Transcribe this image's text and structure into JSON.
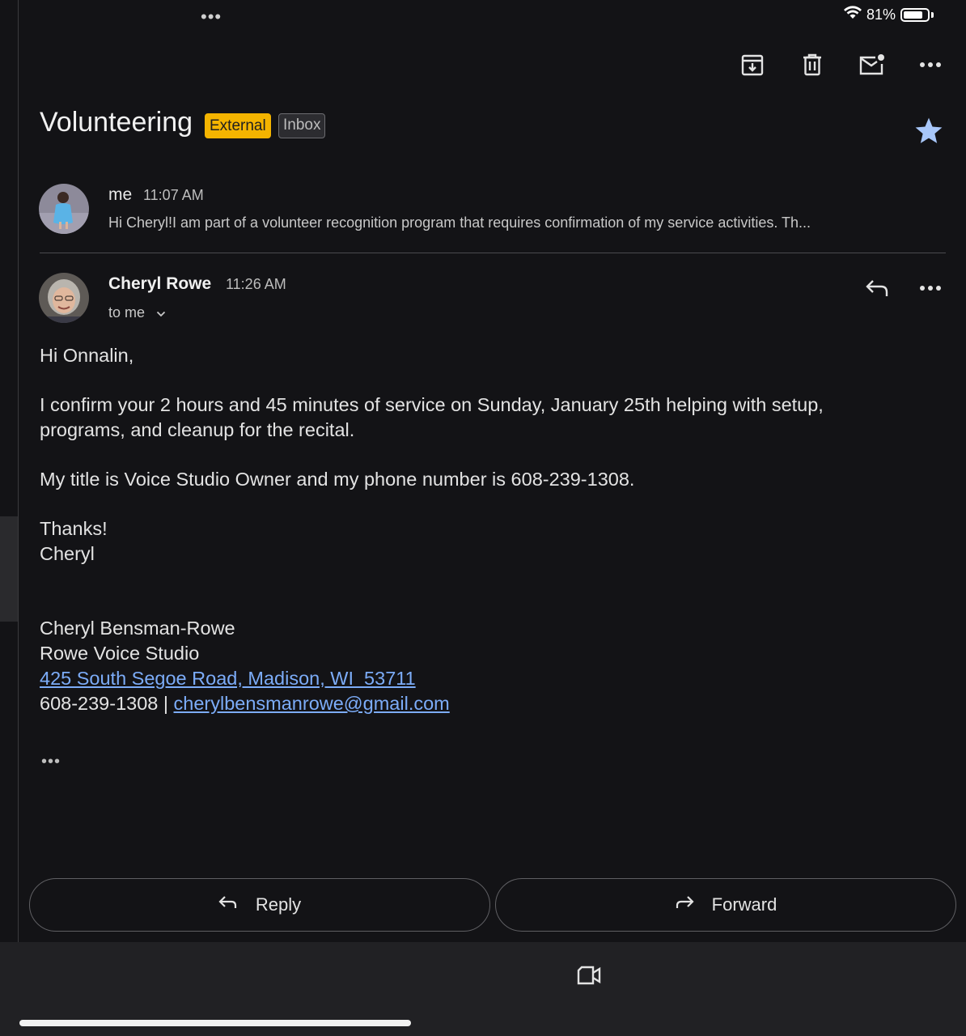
{
  "status_bar": {
    "battery": "81%",
    "battery_level": 0.81
  },
  "toolbar": {
    "archive_icon": "archive-icon",
    "delete_icon": "trash-icon",
    "mark_unread_icon": "mark-unread-icon",
    "more_icon": "more-horizontal-icon"
  },
  "thread": {
    "subject": "Volunteering",
    "labels": [
      "External",
      "Inbox"
    ],
    "starred": true
  },
  "message1": {
    "sender": "me",
    "time": "11:07 AM",
    "snippet": "Hi Cheryl!I am part of a volunteer recognition program that requires confirmation of my service activities. Th..."
  },
  "message2": {
    "sender": "Cheryl Rowe",
    "time": "11:26 AM",
    "recipient": "to me",
    "body": {
      "greeting": "Hi Onnalin,",
      "para1_line1": "I confirm your 2 hours and 45 minutes of service on Sunday, January 25th helping with setup,",
      "para1_line2": "programs, and cleanup for the recital.",
      "para2": "My title is Voice Studio Owner and my phone number is 608-239-1308.",
      "thanks": "Thanks!",
      "signoff": "Cheryl"
    },
    "signature": {
      "name": "Cheryl Bensman-Rowe",
      "company": "Rowe Voice Studio",
      "address": "425 South Segoe Road, Madison, WI  53711",
      "phone": "608-239-1308 | ",
      "email": "cherylbensmanrowe@gmail.com"
    },
    "trimmed_indicator": "•••"
  },
  "actions": {
    "reply": "Reply",
    "forward": "Forward"
  },
  "colors": {
    "background": "#131316",
    "accent_link": "#7cacf8",
    "external_badge": "#f4b400",
    "star": "#a8c7fa"
  }
}
